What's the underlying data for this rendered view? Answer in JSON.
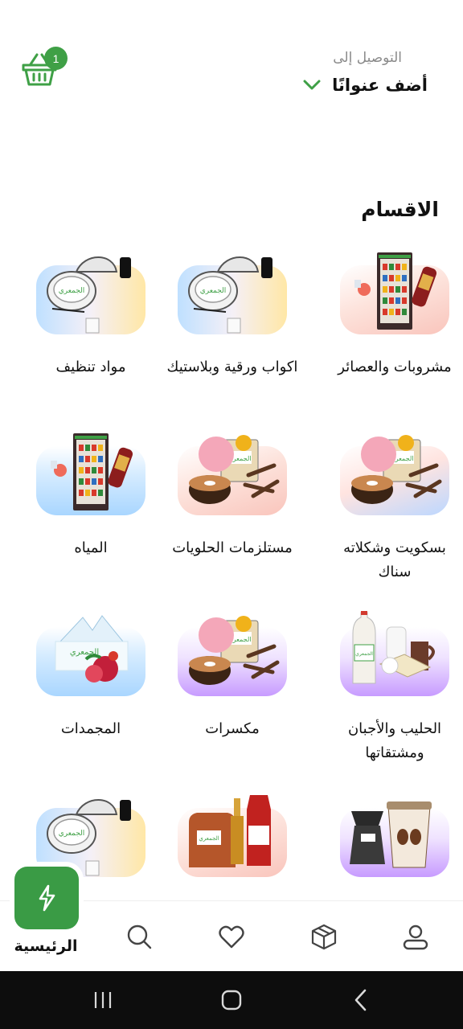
{
  "header": {
    "deliver_label": "التوصيل إلى",
    "address_text": "أضف عنوانًا",
    "cart_count": "1"
  },
  "section_title": "الاقسام",
  "categories": [
    {
      "label": "مشروبات والعصائر",
      "icon": "drinks-fridge-icon"
    },
    {
      "label": "اكواب ورقية وبلاستيك",
      "icon": "paper-cups-icon"
    },
    {
      "label": "مواد تنظيف",
      "icon": "cleaning-supplies-icon"
    },
    {
      "label": "بسكويت وشكلاته سناك",
      "icon": "biscuits-chocolate-icon"
    },
    {
      "label": "مستلزمات الحلويات",
      "icon": "sweets-supplies-icon"
    },
    {
      "label": "المياه",
      "icon": "water-fridge-icon"
    },
    {
      "label": "الحليب والأجبان ومشتقاتها",
      "icon": "dairy-icon"
    },
    {
      "label": "مكسرات",
      "icon": "nuts-icon"
    },
    {
      "label": "المجمدات",
      "icon": "frozen-icon"
    },
    {
      "label": "",
      "icon": "coffee-icon"
    },
    {
      "label": "",
      "icon": "sauces-icon"
    },
    {
      "label": "",
      "icon": "cleaning-supplies-icon"
    }
  ],
  "bottom_nav": {
    "home_label": "الرئيسية",
    "items": [
      "home-icon",
      "search-icon",
      "heart-icon",
      "box-icon",
      "profile-icon"
    ]
  },
  "colors": {
    "brand_green": "#3a9b45",
    "badge_green": "#3fa046"
  }
}
